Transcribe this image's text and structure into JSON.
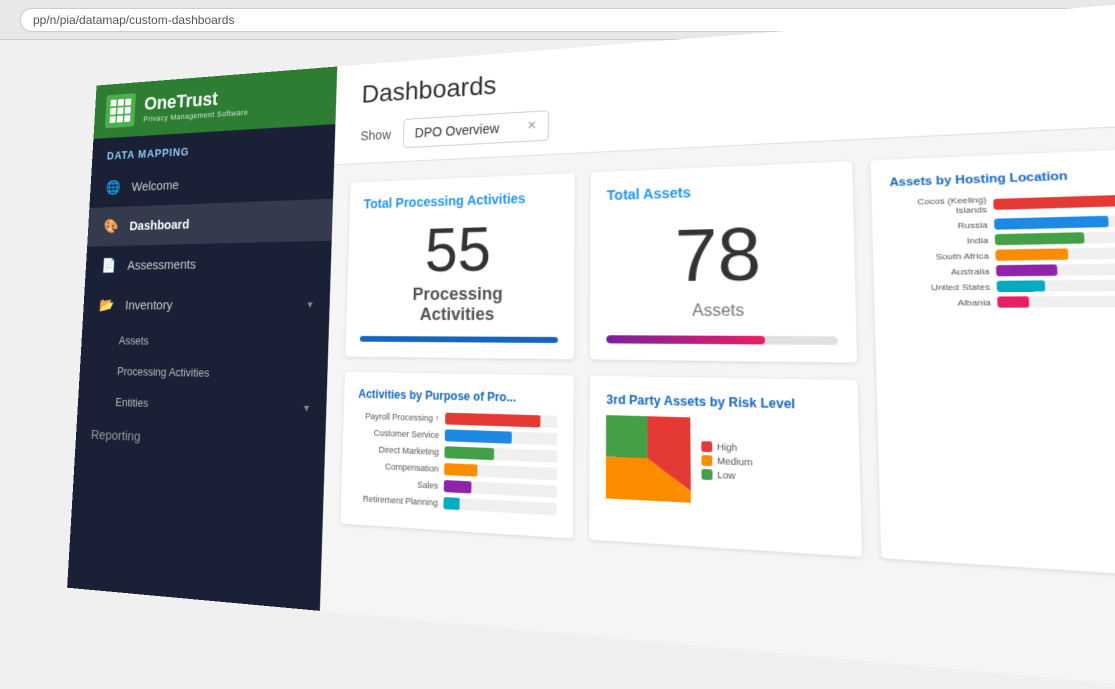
{
  "browser": {
    "address": "pp/n/pia/datamap/custom-dashboards"
  },
  "sidebar": {
    "logo_name": "OneTrust",
    "logo_subtitle": "Privacy Management Software",
    "section_title": "DATA MAPPING",
    "items": [
      {
        "id": "welcome",
        "label": "Welcome",
        "icon": "🌐",
        "active": false
      },
      {
        "id": "dashboard",
        "label": "Dashboard",
        "icon": "🎨",
        "active": true
      },
      {
        "id": "assessments",
        "label": "Assessments",
        "icon": "📄",
        "active": false
      },
      {
        "id": "inventory",
        "label": "Inventory",
        "icon": "📂",
        "active": false,
        "expand": true
      },
      {
        "id": "assets",
        "label": "Assets",
        "icon": "",
        "sub": true
      },
      {
        "id": "processing-activities",
        "label": "Processing Activities",
        "icon": "",
        "sub": true
      },
      {
        "id": "entities",
        "label": "Entities",
        "icon": "",
        "sub": true,
        "expand": true
      },
      {
        "id": "reporting",
        "label": "Reporting",
        "icon": "📊",
        "partial": true
      }
    ]
  },
  "page": {
    "title": "Dashboards",
    "show_label": "Show",
    "show_value": "DPO Overview",
    "show_x": "×"
  },
  "cards": {
    "total_processing": {
      "title": "Total Processing Activities",
      "number": "55",
      "label1": "Processing",
      "label2": "Activities"
    },
    "total_assets": {
      "title": "Total Assets",
      "number": "78",
      "label": "Assets",
      "progress_pct": 70
    },
    "activities_by_purpose": {
      "title": "Activities by Purpose of Pro...",
      "rows": [
        {
          "label": "Payroll Processing ↑",
          "pct": 85,
          "color": "#e53935"
        },
        {
          "label": "Customer Service",
          "pct": 60,
          "color": "#1e88e5"
        },
        {
          "label": "Direct Marketing",
          "pct": 45,
          "color": "#43a047"
        },
        {
          "label": "Compensation",
          "pct": 30,
          "color": "#fb8c00"
        },
        {
          "label": "Sales",
          "pct": 25,
          "color": "#8e24aa"
        },
        {
          "label": "Retirement Planning",
          "pct": 15,
          "color": "#00acc1"
        }
      ],
      "axis_labels": [
        "0",
        "2",
        "4"
      ]
    },
    "third_party_assets": {
      "title": "3rd Party Assets by Risk Level",
      "segments": [
        {
          "label": "High",
          "pct": 35,
          "color": "#e53935"
        },
        {
          "label": "Medium",
          "pct": 40,
          "color": "#fb8c00"
        },
        {
          "label": "Low",
          "pct": 25,
          "color": "#43a047"
        }
      ]
    },
    "assets_by_hosting": {
      "title": "Assets by Hosting Location",
      "rows": [
        {
          "label": "Cocos (Keeling) Islands",
          "pct": 90,
          "color": "#e53935"
        },
        {
          "label": "Russia",
          "pct": 70,
          "color": "#1e88e5"
        },
        {
          "label": "India",
          "pct": 55,
          "color": "#43a047"
        },
        {
          "label": "South Africa",
          "pct": 45,
          "color": "#fb8c00"
        },
        {
          "label": "Australia",
          "pct": 38,
          "color": "#8e24aa"
        },
        {
          "label": "United States",
          "pct": 30,
          "color": "#00acc1"
        },
        {
          "label": "Albania",
          "pct": 20,
          "color": "#e91e63"
        }
      ]
    }
  }
}
